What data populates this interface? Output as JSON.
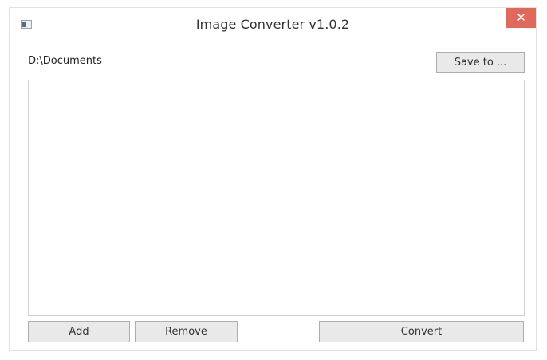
{
  "window": {
    "title": "Image Converter v1.0.2",
    "close_glyph": "✕",
    "app_icon": "window-app-icon"
  },
  "output": {
    "path": "D:\\Documents",
    "save_to_label": "Save to ..."
  },
  "file_list": {
    "items": []
  },
  "actions": {
    "add_label": "Add",
    "remove_label": "Remove",
    "convert_label": "Convert"
  },
  "colors": {
    "close_button": "#e0695c",
    "button_face": "#e9e9e9",
    "button_border": "#adadad"
  }
}
